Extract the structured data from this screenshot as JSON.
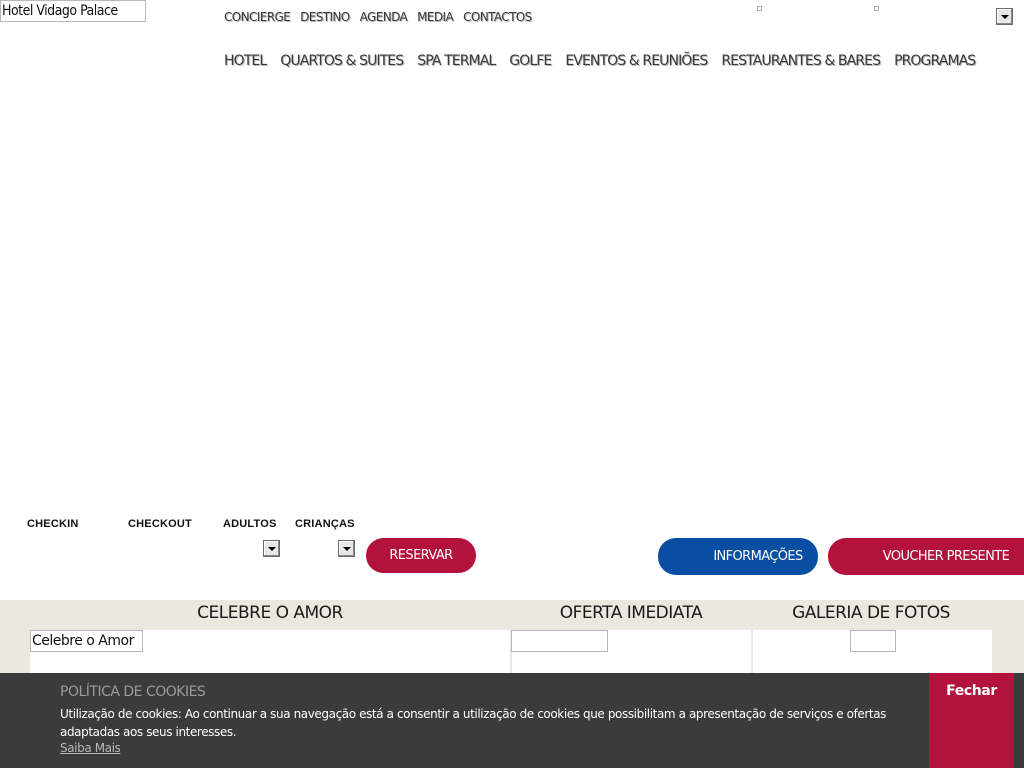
{
  "header": {
    "logo_alt": "Hotel Vidago Palace",
    "top_nav": [
      "CONCIERGE",
      "DESTINO",
      "AGENDA",
      "MEDIA",
      "CONTACTOS"
    ],
    "main_nav": [
      "HOTEL",
      "QUARTOS & SUITES",
      "SPA TERMAL",
      "GOLFE",
      "EVENTOS & REUNIÕES",
      "RESTAURANTES & BARES",
      "PROGRAMAS"
    ]
  },
  "booking": {
    "checkin_label": "CHECKIN",
    "checkout_label": "CHECKOUT",
    "adults_label": "ADULTOS",
    "children_label": "CRIANÇAS",
    "reserve_label": "RESERVAR",
    "info_label": "INFORMAÇÕES",
    "voucher_label": "VOUCHER PRESENTE"
  },
  "sections": {
    "amor_title": "CELEBRE O AMOR",
    "amor_image_alt": "Celebre o Amor",
    "oferta_title": "OFERTA IMEDIATA",
    "galeria_title": "GALERIA DE FOTOS"
  },
  "cookie": {
    "title": "POLÍTICA DE COOKIES",
    "text": "Utilização de cookies: Ao continuar a sua navegação está a consentir a utilização de cookies que possibilitam a apresentação de serviços e ofertas adaptadas aos seus interesses.",
    "link": "Saiba Mais",
    "close": "Fechar"
  },
  "colors": {
    "brand_red": "#b3123c",
    "brand_blue": "#0a4ea3",
    "strip_bg": "#ebe8df",
    "cookie_bg": "#3b3b3b"
  }
}
